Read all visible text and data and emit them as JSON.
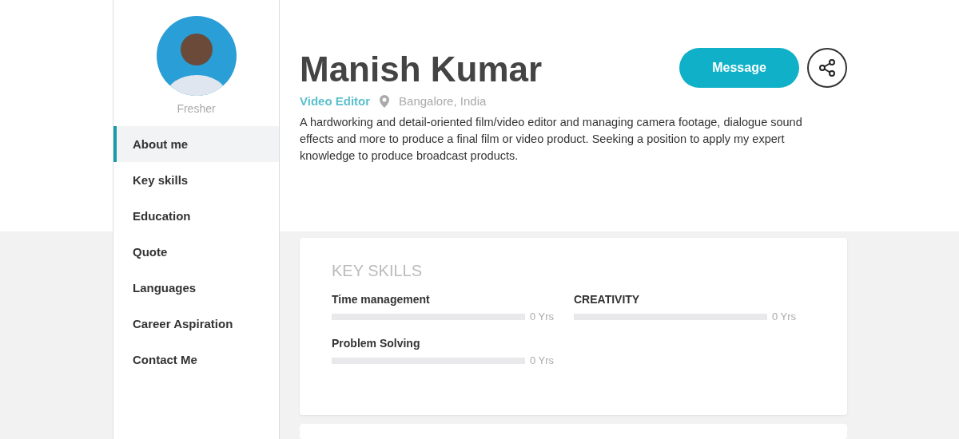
{
  "profile": {
    "status": "Fresher",
    "name": "Manish Kumar",
    "role": "Video Editor",
    "location": "Bangalore, India",
    "about": "A hardworking and detail-oriented film/video editor and managing camera footage, dialogue sound effects and more to produce a final film or video product. Seeking a position to apply my expert knowledge to produce broadcast products."
  },
  "actions": {
    "message": "Message"
  },
  "sidebar": {
    "items": [
      {
        "label": "About me",
        "selected": true
      },
      {
        "label": "Key skills",
        "selected": false
      },
      {
        "label": "Education",
        "selected": false
      },
      {
        "label": "Quote",
        "selected": false
      },
      {
        "label": "Languages",
        "selected": false
      },
      {
        "label": "Career Aspiration",
        "selected": false
      },
      {
        "label": "Contact Me",
        "selected": false
      }
    ]
  },
  "key_skills": {
    "title": "KEY SKILLS",
    "skills": [
      {
        "name": "Time management",
        "reading": "0 Yrs"
      },
      {
        "name": "CREATIVITY",
        "reading": "0 Yrs"
      },
      {
        "name": "Problem Solving",
        "reading": "0 Yrs"
      }
    ]
  }
}
